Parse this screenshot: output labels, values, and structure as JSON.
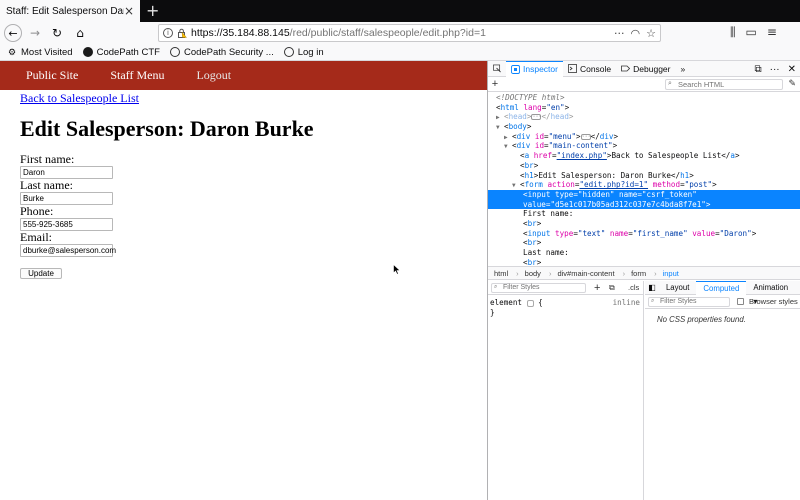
{
  "tab": {
    "title": "Staff: Edit Salesperson Daron Burke",
    "close": "×",
    "new_tab": "+"
  },
  "nav": {
    "back": "←",
    "forward": "→",
    "reload": "↻",
    "home": "⌂",
    "url_host": "https://35.184.88.145",
    "url_path": "/red/public/staff/salespeople/edit.php?id=1",
    "page_actions": "···",
    "pocket": "◠",
    "bookmark_star": "☆",
    "right_tools": [
      "⫼",
      "▭",
      "≡"
    ]
  },
  "bookmarks": [
    {
      "icon": "gear-icon",
      "glyph": "⚙",
      "label": "Most Visited"
    },
    {
      "icon": "codepath-icon",
      "glyph": "",
      "label": "CodePath CTF"
    },
    {
      "icon": "globe-icon",
      "glyph": "",
      "label": "CodePath Security ..."
    },
    {
      "icon": "globe-icon",
      "glyph": "",
      "label": "Log in"
    }
  ],
  "page": {
    "menu": [
      "Public Site",
      "Staff Menu",
      "Logout"
    ],
    "back_link": "Back to Salespeople List",
    "heading": "Edit Salesperson: Daron Burke",
    "fields": [
      {
        "label": "First name:",
        "value": "Daron"
      },
      {
        "label": "Last name:",
        "value": "Burke"
      },
      {
        "label": "Phone:",
        "value": "555-925-3685"
      },
      {
        "label": "Email:",
        "value": "dburke@salesperson.com"
      }
    ],
    "submit": "Update",
    "colors": {
      "menu_bg": "#a52a1a",
      "link": "#0000ee"
    }
  },
  "devtools": {
    "tabs": [
      "Inspector",
      "Console",
      "Debugger"
    ],
    "more_tabs": "»",
    "right_tools": [
      "⧉",
      "···",
      "✕"
    ],
    "add_node": "+",
    "search_placeholder": "Search HTML",
    "markup": {
      "doctype": "<!DOCTYPE html>",
      "html_tag": "html",
      "html_attr": "lang",
      "html_val": "\"en\"",
      "head_tag": "head",
      "body_tag": "body",
      "div_tag": "div",
      "menu_attr": "id",
      "menu_val": "\"menu\"",
      "main_val": "\"main-content\"",
      "br_tag": "br",
      "a_tag": "a",
      "a_attr": "href",
      "a_val": "\"index.php\"",
      "a_text": "Back to Salespeople List",
      "h1_tag": "h1",
      "h1_text": "Edit Salesperson: Daron Burke",
      "form_tag": "form",
      "form_action_attr": "action",
      "form_action_val": "\"edit.php?id=1\"",
      "form_method_attr": "method",
      "form_method_val": "\"post\"",
      "input_tag": "input",
      "type_attr": "type",
      "hidden_val": "\"hidden\"",
      "name_attr": "name",
      "csrf_val": "\"csrf_token\"",
      "value_attr": "value",
      "csrf_token_val": "\"d5e1c017b05ad312c037e7c4bda8f7e1\"",
      "first_name_text": "First name:",
      "text_val": "\"text\"",
      "first_name_val": "\"first_name\"",
      "daron_val": "\"Daron\"",
      "last_name_text": "Last name:"
    },
    "breadcrumbs": [
      "html",
      "body",
      "div#main-content",
      "form",
      "input"
    ],
    "rules": {
      "filter_placeholder": "Filter Styles",
      "add_rule": "+",
      "pseudo": "⧉",
      "cls": ".cls",
      "selector": "element",
      "open_brace": "{",
      "close_brace": "}",
      "source": "inline"
    },
    "computed": {
      "tabs": [
        "Layout",
        "Computed",
        "Animation"
      ],
      "animation_caret": "▾",
      "filter_placeholder": "Filter Styles",
      "browser_styles": "Browser styles",
      "empty_message": "No CSS properties found."
    },
    "colors": {
      "accent": "#0a84ff",
      "tag": "#0074e8",
      "attr_name": "#dd00a9",
      "attr_value": "#003eaa"
    }
  }
}
